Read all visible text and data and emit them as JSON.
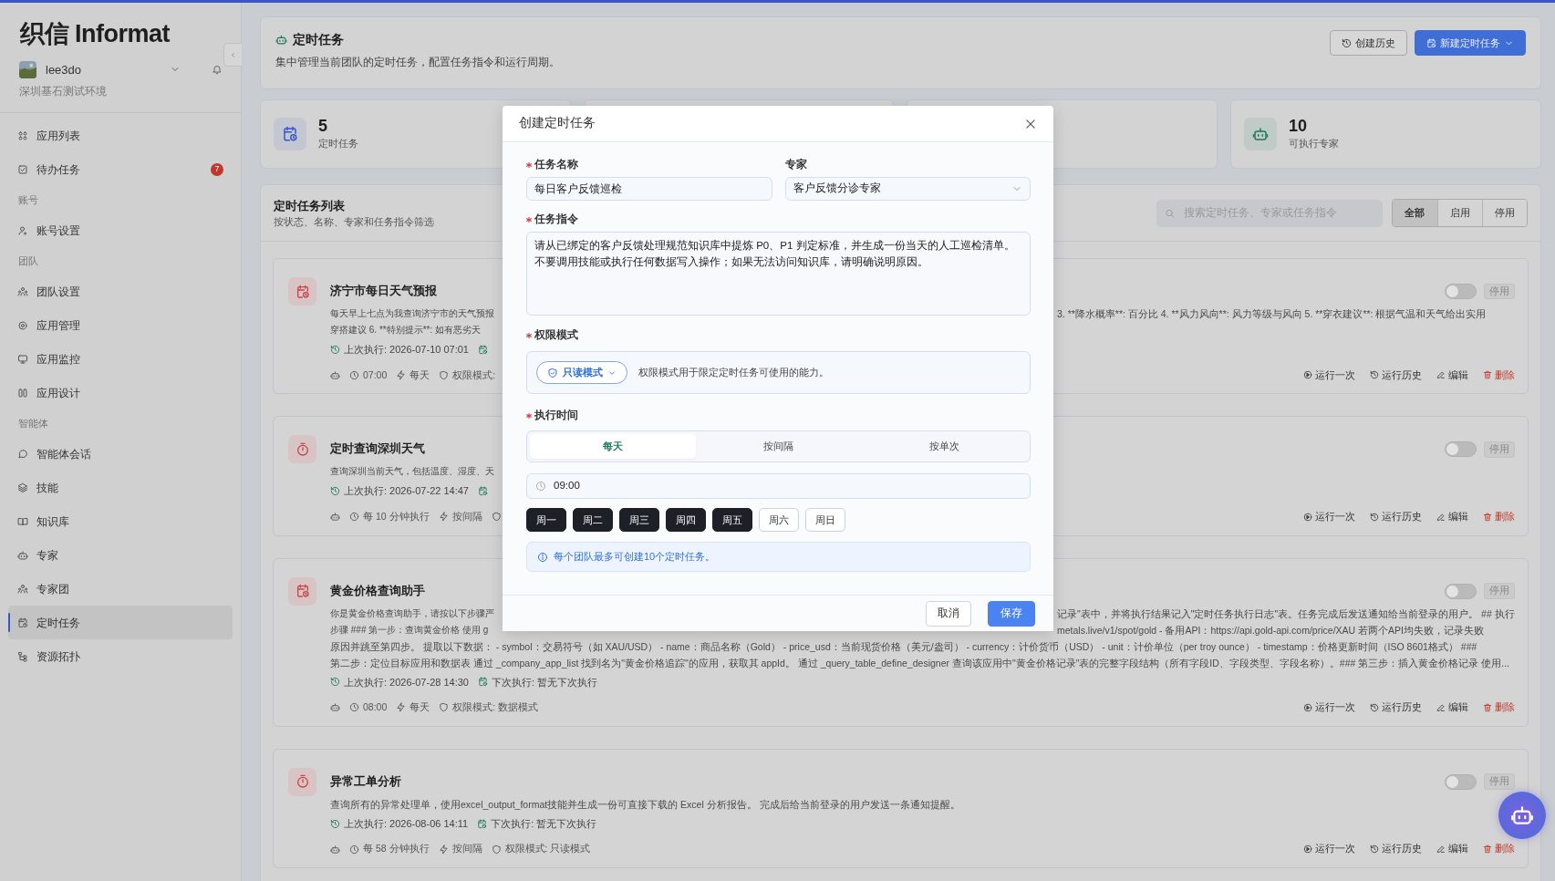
{
  "sidebar": {
    "logo": "织信 Informat",
    "user": {
      "name": "lee3do",
      "environment": "深圳基石测试环境"
    },
    "items": [
      {
        "kind": "item",
        "label": "应用列表",
        "selected": false
      },
      {
        "kind": "item",
        "label": "待办任务",
        "selected": false,
        "badge": "7"
      },
      {
        "kind": "section",
        "label": "账号"
      },
      {
        "kind": "item",
        "label": "账号设置",
        "selected": false
      },
      {
        "kind": "section",
        "label": "团队"
      },
      {
        "kind": "item",
        "label": "团队设置",
        "selected": false
      },
      {
        "kind": "item",
        "label": "应用管理",
        "selected": false
      },
      {
        "kind": "item",
        "label": "应用监控",
        "selected": false
      },
      {
        "kind": "item",
        "label": "应用设计",
        "selected": false
      },
      {
        "kind": "section",
        "label": "智能体"
      },
      {
        "kind": "item",
        "label": "智能体会话",
        "selected": false
      },
      {
        "kind": "item",
        "label": "技能",
        "selected": false
      },
      {
        "kind": "item",
        "label": "知识库",
        "selected": false
      },
      {
        "kind": "item",
        "label": "专家",
        "selected": false
      },
      {
        "kind": "item",
        "label": "专家团",
        "selected": false
      },
      {
        "kind": "item",
        "label": "定时任务",
        "selected": true
      },
      {
        "kind": "item",
        "label": "资源拓扑",
        "selected": false
      }
    ]
  },
  "header": {
    "title": "定时任务",
    "subtitle": "集中管理当前团队的定时任务，配置任务指令和运行周期。",
    "buttons": [
      {
        "label": "创建历史",
        "kind": "secondary"
      },
      {
        "label": "新建定时任务",
        "kind": "primary"
      }
    ]
  },
  "stats": [
    {
      "value": "5",
      "label": "定时任务",
      "kind": "tasks"
    },
    {
      "value": "10",
      "label": "可执行专家",
      "kind": "experts"
    }
  ],
  "task_list": {
    "title": "定时任务列表",
    "subtitle": "按状态、名称、专家和任务指令筛选",
    "search": {
      "placeholder": "搜索定时任务、专家或任务指令"
    },
    "filters": [
      {
        "label": "全部",
        "selected": true
      },
      {
        "label": "启用",
        "selected": false
      },
      {
        "label": "停用",
        "selected": false
      }
    ],
    "tasks": [
      {
        "kind": "daily",
        "title": "济宁市每日天气预报",
        "enabled": false,
        "status": "停用",
        "description": [
          {
            "left": "每天早上七点为我查询济宁市的天气预报",
            "right": "3. **降水概率**: 百分比 4. **风力风向**: 风力等级与风向 5. **穿衣建议**: 根据气温和天气给出实用"
          },
          {
            "left": "穿搭建议 6. **特别提示**: 如有恶劣天"
          }
        ],
        "last_run": "上次执行: 2026-07-10 07:01",
        "schedule": "07:00",
        "frequency": "每天",
        "permission": "权限模式:",
        "actions": [
          {
            "label": "运行一次",
            "kind": "run"
          },
          {
            "label": "运行历史",
            "kind": "history"
          },
          {
            "label": "编辑",
            "kind": "edit"
          },
          {
            "label": "删除",
            "kind": "delete"
          }
        ]
      },
      {
        "kind": "interval",
        "title": "定时查询深圳天气",
        "enabled": false,
        "status": "停用",
        "description": [
          {
            "left": "查询深圳当前天气，包括温度、湿度、天"
          }
        ],
        "last_run": "上次执行: 2026-07-22 14:47",
        "schedule": "每 10 分钟执行",
        "frequency": "按间隔",
        "actions": [
          {
            "label": "运行一次",
            "kind": "run"
          },
          {
            "label": "运行历史",
            "kind": "history"
          },
          {
            "label": "编辑",
            "kind": "edit"
          },
          {
            "label": "删除",
            "kind": "delete"
          }
        ]
      },
      {
        "kind": "daily",
        "title": "黄金价格查询助手",
        "enabled": false,
        "status": "停用",
        "description": [
          {
            "left": "你是黄金价格查询助手，请按以下步骤严",
            "right": "记录\"表中，并将执行结果记入\"定时任务执行日志\"表。任务完成后发送通知给当前登录的用户。 ## 执行"
          },
          {
            "left": "步骤 ### 第一步：查询黄金价格 使用 g",
            "right": "metals.live/v1/spot/gold - 备用API：https://api.gold-api.com/price/XAU 若两个API均失败，记录失败"
          },
          {
            "text": "原因并跳至第四步。 提取以下数据： - symbol：交易符号（如 XAU/USD） - name：商品名称（Gold） - price_usd：当前现货价格（美元/盎司） - currency：计价货币（USD） - unit：计价单位（per troy ounce） - timestamp：价格更新时间（ISO 8601格式） ###"
          },
          {
            "text": "第二步：定位目标应用和数据表 通过 _company_app_list 找到名为\"黄金价格追踪\"的应用，获取其 appId。 通过 _query_table_define_designer 查询该应用中\"黄金价格记录\"表的完整字段结构（所有字段ID、字段类型、字段名称）。### 第三步：插入黄金价格记录 使用..."
          }
        ],
        "last_run": "上次执行: 2026-07-28 14:30",
        "next_run": "下次执行: 暂无下次执行",
        "schedule": "08:00",
        "frequency": "每天",
        "permission": "权限模式: 数据模式",
        "actions": [
          {
            "label": "运行一次",
            "kind": "run"
          },
          {
            "label": "运行历史",
            "kind": "history"
          },
          {
            "label": "编辑",
            "kind": "edit"
          },
          {
            "label": "删除",
            "kind": "delete"
          }
        ]
      },
      {
        "kind": "interval",
        "title": "异常工单分析",
        "enabled": false,
        "status": "停用",
        "description": [
          {
            "text": "查询所有的异常处理单，使用excel_output_format技能并生成一份可直接下载的 Excel 分析报告。 完成后给当前登录的用户发送一条通知提醒。"
          }
        ],
        "last_run": "上次执行: 2026-08-06 14:11",
        "next_run": "下次执行: 暂无下次执行",
        "schedule": "每 58 分钟执行",
        "frequency": "按间隔",
        "permission": "权限模式: 只读模式",
        "actions": [
          {
            "label": "运行一次",
            "kind": "run"
          },
          {
            "label": "运行历史",
            "kind": "history"
          },
          {
            "label": "编辑",
            "kind": "edit"
          },
          {
            "label": "删除",
            "kind": "delete"
          }
        ]
      }
    ]
  },
  "dialog": {
    "title": "创建定时任务",
    "name_field": {
      "label": "任务名称",
      "required": true,
      "value": "每日客户反馈巡检"
    },
    "expert_field": {
      "label": "专家",
      "value": "客户反馈分诊专家"
    },
    "instruction_field": {
      "label": "任务指令",
      "required": true,
      "value": "请从已绑定的客户反馈处理规范知识库中提炼 P0、P1 判定标准，并生成一份当天的人工巡检清单。不要调用技能或执行任何数据写入操作；如果无法访问知识库，请明确说明原因。"
    },
    "permission": {
      "label": "权限模式",
      "required": true,
      "mode": "只读模式",
      "hint": "权限模式用于限定定时任务可使用的能力。"
    },
    "schedule": {
      "label": "执行时间",
      "required": true,
      "tabs": [
        {
          "label": "每天",
          "selected": true
        },
        {
          "label": "按间隔",
          "selected": false
        },
        {
          "label": "按单次",
          "selected": false
        }
      ],
      "time": "09:00",
      "weekdays": [
        {
          "label": "周一",
          "selected": true
        },
        {
          "label": "周二",
          "selected": true
        },
        {
          "label": "周三",
          "selected": true
        },
        {
          "label": "周四",
          "selected": true
        },
        {
          "label": "周五",
          "selected": true
        },
        {
          "label": "周六",
          "selected": false
        },
        {
          "label": "周日",
          "selected": false
        }
      ]
    },
    "notice": "每个团队最多可创建10个定时任务。",
    "buttons": [
      {
        "label": "取消",
        "kind": "secondary"
      },
      {
        "label": "保存",
        "kind": "primary"
      }
    ]
  }
}
